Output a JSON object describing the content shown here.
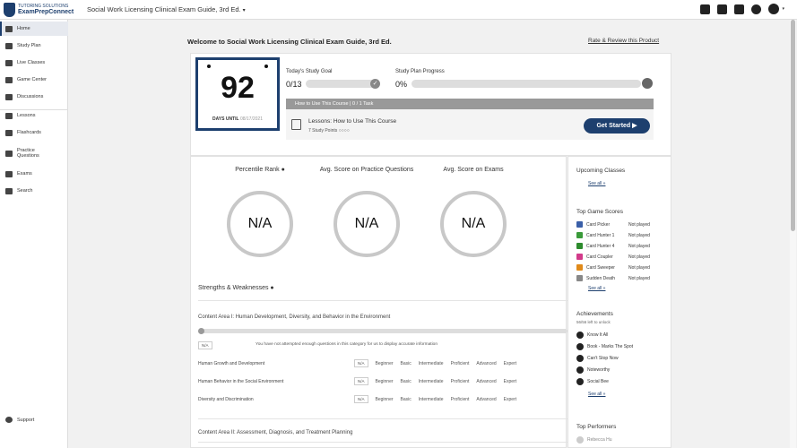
{
  "logo": {
    "line1": "TUTORING SOLUTIONS",
    "line2": "ExamPrepConnect"
  },
  "header": {
    "course_title": "Social Work Licensing Clinical Exam Guide, 3rd Ed.",
    "caret": "▾"
  },
  "sidebar": {
    "items": [
      {
        "label": "Home",
        "icon": "home-icon"
      },
      {
        "label": "Study Plan",
        "icon": "calendar-icon"
      },
      {
        "label": "Live Classes",
        "icon": "video-icon"
      },
      {
        "label": "Game Center",
        "icon": "gamepad-icon"
      },
      {
        "label": "Discussions",
        "icon": "chat-icon"
      },
      {
        "label": "Lessons",
        "icon": "book-icon"
      },
      {
        "label": "Flashcards",
        "icon": "cards-icon"
      },
      {
        "label": "Practice Questions",
        "icon": "question-icon"
      },
      {
        "label": "Exams",
        "icon": "exam-icon"
      },
      {
        "label": "Search",
        "icon": "search-icon"
      }
    ],
    "support": "Support"
  },
  "main": {
    "welcome": "Welcome to Social Work Licensing Clinical Exam Guide, 3rd Ed.",
    "rate_link": "Rate & Review this Product"
  },
  "countdown": {
    "days": "92",
    "label": "DAYS UNTIL",
    "date": "08/17/2021"
  },
  "study_goal": {
    "label": "Today's Study Goal",
    "value": "0/13",
    "progress": 0
  },
  "study_progress": {
    "label": "Study Plan Progress",
    "value": "0%",
    "progress": 0
  },
  "task": {
    "header": "How to Use This Course | 0 / 1 Task",
    "lesson_title": "Lessons: How to Use This Course",
    "lesson_sub": "7 Study Points",
    "button": "Get Started ▶"
  },
  "stats": [
    {
      "title": "Percentile Rank",
      "value": "N/A"
    },
    {
      "title": "Avg. Score on Practice Questions",
      "value": "N/A"
    },
    {
      "title": "Avg. Score on Exams",
      "value": "N/A"
    }
  ],
  "strengths": {
    "title": "Strengths & Weaknesses",
    "areas": [
      {
        "title": "Content Area I: Human Development, Diversity, and Behavior in the Environment",
        "na": "N/A",
        "message": "You have not attempted enough questions in this category for us to display accurate information",
        "subs": [
          {
            "name": "Human Growth and Development"
          },
          {
            "name": "Human Behavior in the Social Environment"
          },
          {
            "name": "Diversity and Discrimination"
          }
        ]
      },
      {
        "title": "Content Area II: Assessment, Diagnosis, and Treatment Planning"
      }
    ],
    "levels": [
      "N/A",
      "Beginner",
      "Basic",
      "Intermediate",
      "Proficient",
      "Advanced",
      "Expert"
    ]
  },
  "side": {
    "upcoming": {
      "title": "Upcoming Classes",
      "see_all": "See all »"
    },
    "games": {
      "title": "Top Game Scores",
      "see_all": "See all »",
      "rows": [
        {
          "name": "Card Picker",
          "status": "Not played",
          "color": "#3a5fa8"
        },
        {
          "name": "Card Hunter 1",
          "status": "Not played",
          "color": "#3a9a3a"
        },
        {
          "name": "Card Hunter 4",
          "status": "Not played",
          "color": "#2e8b2e"
        },
        {
          "name": "Card Coupler",
          "status": "Not played",
          "color": "#d23a8a"
        },
        {
          "name": "Card Sweeper",
          "status": "Not played",
          "color": "#e08a1a"
        },
        {
          "name": "Sudden Death",
          "status": "Not played",
          "color": "#888888"
        }
      ]
    },
    "achievements": {
      "title": "Achievements",
      "sub": "56/56 left to unlock",
      "see_all": "See all »",
      "rows": [
        "Know It All",
        "Book - Marks The Spot",
        "Can't Stop Now",
        "Noteworthy",
        "Social Bee"
      ]
    },
    "performers": {
      "title": "Top Performers",
      "first": "Rebecca Hu"
    }
  }
}
